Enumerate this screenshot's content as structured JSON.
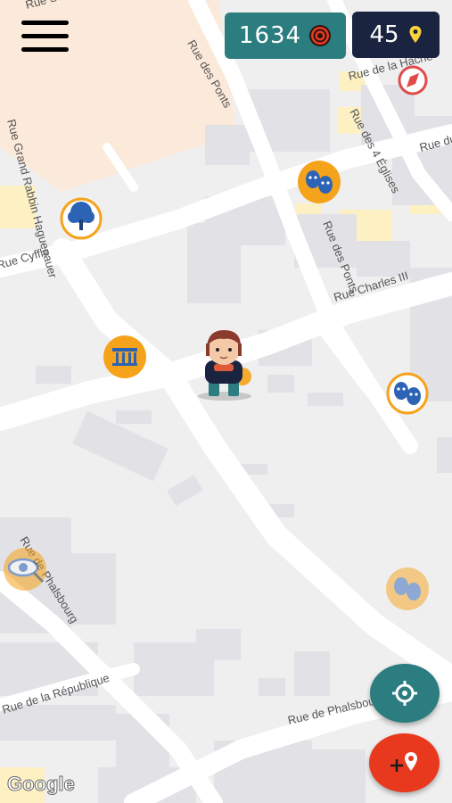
{
  "hud": {
    "coins_value": "1634",
    "coins_icon": "coin-target-icon",
    "pins_value": "45",
    "pins_icon": "map-pin-icon"
  },
  "map": {
    "streets": {
      "rue_su": "Rue Su",
      "rue_des_ponts_top": "Rue des Ponts",
      "rue_de_la_hache": "Rue de la Hache",
      "rue_des_4_eglises": "Rue des 4 Églises",
      "rue_du_fo": "Rue du Fo",
      "rue_grand_rabbin": "Rue Grand Rabbin Haguenauer",
      "rue_des_ponts_mid": "Rue des Ponts",
      "rue_cyffle": "Rue Cyfflé",
      "rue_charles_iii": "Rue Charles III",
      "rue_phalsbourg_left": "Rue de Phalsbourg",
      "rue_republique": "Rue de la République",
      "rue_phalsbourg_bottom": "Rue de Phalsbourg"
    },
    "attribution": "Google"
  },
  "pois": [
    {
      "name": "tree-poi",
      "icon": "tree-icon"
    },
    {
      "name": "theater-poi-top",
      "icon": "theater-masks-icon"
    },
    {
      "name": "monument-poi",
      "icon": "column-icon"
    },
    {
      "name": "theater-poi-right",
      "icon": "theater-masks-icon"
    },
    {
      "name": "theater-poi-faded",
      "icon": "theater-masks-icon"
    },
    {
      "name": "eye-poi",
      "icon": "eye-icon"
    },
    {
      "name": "compass-poi",
      "icon": "compass-icon"
    }
  ],
  "controls": {
    "menu_icon": "hamburger-menu-icon",
    "locate_icon": "crosshair-icon",
    "add_pin_icon": "add-pin-icon"
  },
  "colors": {
    "teal": "#2c7d80",
    "navy": "#1a2440",
    "red": "#e8391f",
    "orange": "#f5a31a",
    "pin_yellow": "#f7d33c"
  }
}
